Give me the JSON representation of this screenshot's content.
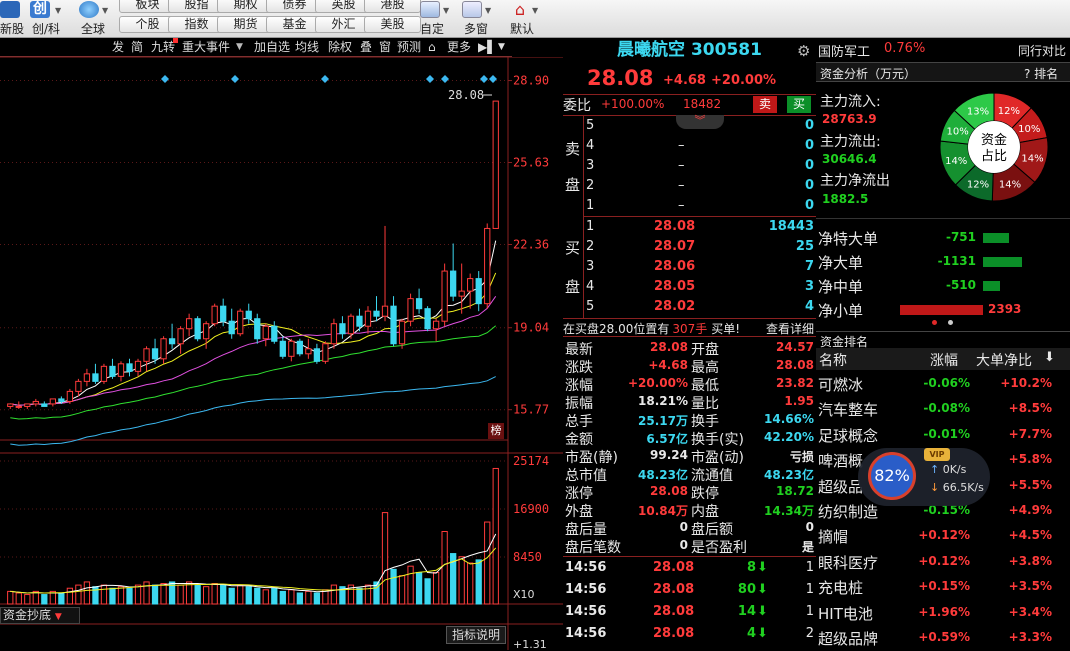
{
  "toolbar": {
    "left_labels": [
      "新股",
      "创/科",
      "全球"
    ],
    "buttons_row1": [
      "板块",
      "股指",
      "期权",
      "债券",
      "英股",
      "港股"
    ],
    "buttons_row2": [
      "个股",
      "指数",
      "期货",
      "基金",
      "外汇",
      "美股"
    ],
    "right_labels": [
      "自定",
      "多窗",
      "默认"
    ]
  },
  "chart_toolbar": {
    "items": [
      "发",
      "简",
      "九转",
      "重大事件",
      "加自选",
      "均线",
      "除权",
      "叠",
      "窗",
      "预测",
      "更多"
    ]
  },
  "kline": {
    "last_price_label": "28.08",
    "price_ticks": [
      "28.90",
      "25.63",
      "22.36",
      "19.04",
      "15.77"
    ],
    "volume_ticks": [
      "25174",
      "16900",
      "8450"
    ],
    "volume_unit": "X10",
    "rank_tag": "榜",
    "bottom_indicator": "资金抄底",
    "indicator_help": "指标说明",
    "bottom_tick": "+1.31",
    "candles": [
      [
        15.9,
        16.0,
        15.8,
        16.0
      ],
      [
        15.9,
        16.1,
        15.8,
        15.9
      ],
      [
        15.9,
        16.0,
        15.8,
        16.0
      ],
      [
        16.0,
        16.2,
        15.9,
        16.1
      ],
      [
        16.0,
        16.1,
        15.9,
        15.9
      ],
      [
        16.0,
        16.2,
        15.9,
        16.2
      ],
      [
        16.2,
        16.3,
        16.0,
        16.1
      ],
      [
        16.1,
        16.6,
        16.0,
        16.5
      ],
      [
        16.5,
        17.0,
        16.3,
        16.9
      ],
      [
        16.9,
        17.4,
        16.7,
        17.2
      ],
      [
        17.2,
        17.6,
        16.8,
        16.9
      ],
      [
        16.9,
        17.6,
        16.8,
        17.5
      ],
      [
        17.5,
        17.8,
        17.0,
        17.1
      ],
      [
        17.1,
        17.7,
        16.9,
        17.6
      ],
      [
        17.6,
        17.8,
        17.1,
        17.3
      ],
      [
        17.3,
        17.8,
        17.1,
        17.7
      ],
      [
        17.7,
        18.3,
        17.3,
        18.2
      ],
      [
        18.2,
        18.6,
        17.6,
        17.8
      ],
      [
        17.8,
        18.7,
        17.6,
        18.6
      ],
      [
        18.6,
        19.2,
        18.2,
        18.4
      ],
      [
        18.4,
        19.1,
        18.0,
        19.0
      ],
      [
        19.0,
        19.6,
        18.7,
        19.4
      ],
      [
        19.4,
        19.5,
        18.5,
        18.6
      ],
      [
        18.6,
        19.3,
        18.2,
        19.2
      ],
      [
        19.2,
        20.0,
        19.1,
        19.9
      ],
      [
        19.9,
        20.2,
        19.1,
        19.3
      ],
      [
        19.3,
        19.8,
        18.6,
        18.8
      ],
      [
        18.8,
        19.8,
        18.7,
        19.7
      ],
      [
        19.7,
        20.0,
        19.2,
        19.4
      ],
      [
        19.4,
        19.6,
        18.4,
        18.6
      ],
      [
        18.6,
        19.2,
        18.3,
        19.1
      ],
      [
        19.1,
        19.3,
        18.4,
        18.5
      ],
      [
        18.5,
        18.7,
        17.8,
        17.9
      ],
      [
        17.9,
        18.6,
        17.7,
        18.5
      ],
      [
        18.5,
        18.6,
        17.9,
        18.0
      ],
      [
        18.0,
        18.6,
        17.8,
        18.2
      ],
      [
        18.2,
        18.4,
        17.6,
        17.7
      ],
      [
        17.7,
        18.5,
        17.6,
        18.4
      ],
      [
        18.4,
        19.4,
        18.2,
        19.2
      ],
      [
        19.2,
        19.5,
        18.6,
        18.8
      ],
      [
        18.8,
        19.6,
        18.6,
        19.5
      ],
      [
        19.5,
        19.8,
        18.9,
        19.1
      ],
      [
        19.1,
        19.9,
        18.8,
        19.7
      ],
      [
        19.7,
        20.3,
        19.3,
        19.5
      ],
      [
        19.5,
        23.1,
        19.3,
        19.9
      ],
      [
        19.9,
        20.3,
        18.3,
        18.4
      ],
      [
        18.4,
        19.4,
        18.2,
        19.3
      ],
      [
        19.3,
        20.4,
        19.1,
        20.2
      ],
      [
        20.2,
        20.6,
        19.6,
        19.8
      ],
      [
        19.8,
        19.9,
        18.9,
        19.0
      ],
      [
        19.0,
        19.4,
        18.5,
        19.3
      ],
      [
        19.3,
        21.6,
        19.1,
        21.3
      ],
      [
        21.3,
        22.4,
        20.1,
        20.3
      ],
      [
        20.3,
        21.6,
        19.6,
        20.5
      ],
      [
        20.5,
        21.2,
        19.8,
        21.0
      ],
      [
        21.0,
        21.3,
        19.7,
        20.0
      ],
      [
        20.0,
        23.2,
        19.8,
        23.0
      ],
      [
        23.0,
        28.08,
        23.0,
        28.08
      ]
    ],
    "volumes": [
      0.4,
      0.35,
      0.3,
      0.4,
      0.3,
      0.4,
      0.35,
      0.5,
      0.6,
      0.7,
      0.55,
      0.6,
      0.5,
      0.55,
      0.5,
      0.6,
      0.7,
      0.6,
      0.65,
      0.7,
      0.6,
      0.7,
      0.6,
      0.55,
      0.65,
      0.6,
      0.5,
      0.6,
      0.55,
      0.5,
      0.45,
      0.5,
      0.4,
      0.45,
      0.35,
      0.4,
      0.35,
      0.45,
      0.6,
      0.55,
      0.6,
      0.5,
      0.6,
      0.7,
      2.9,
      1.1,
      0.9,
      1.2,
      1.0,
      0.8,
      1.0,
      2.3,
      1.6,
      1.5,
      1.3,
      1.4,
      2.6,
      4.3
    ]
  },
  "stock": {
    "name": "晨曦航空",
    "code": "300581",
    "price": "28.08",
    "change": "+4.68",
    "change_pct": "+20.00%",
    "weibi_label": "委比",
    "weibi_pct": "+100.00%",
    "weibi_num": "18482",
    "sell_btn": "卖",
    "buy_btn": "买",
    "sell_label": [
      "卖",
      "盘"
    ],
    "buy_label": [
      "买",
      "盘"
    ],
    "asks": [
      {
        "lvl": "5",
        "price": "",
        "vol": "0"
      },
      {
        "lvl": "4",
        "price": "–",
        "vol": "0"
      },
      {
        "lvl": "3",
        "price": "–",
        "vol": "0"
      },
      {
        "lvl": "2",
        "price": "–",
        "vol": "0"
      },
      {
        "lvl": "1",
        "price": "–",
        "vol": "0"
      }
    ],
    "bids": [
      {
        "lvl": "1",
        "price": "28.08",
        "vol": "18443"
      },
      {
        "lvl": "2",
        "price": "28.07",
        "vol": "25"
      },
      {
        "lvl": "3",
        "price": "28.06",
        "vol": "7"
      },
      {
        "lvl": "4",
        "price": "28.05",
        "vol": "3"
      },
      {
        "lvl": "5",
        "price": "28.02",
        "vol": "4"
      }
    ],
    "position_note_a": "在买盘28.00位置有",
    "position_note_b": "307手",
    "position_note_c": "买单!",
    "position_detail": "查看详细",
    "quotes": [
      [
        "最新",
        "28.08",
        "red",
        "开盘",
        "24.57",
        "red"
      ],
      [
        "涨跌",
        "+4.68",
        "red",
        "最高",
        "28.08",
        "red"
      ],
      [
        "涨幅",
        "+20.00%",
        "red",
        "最低",
        "23.82",
        "red"
      ],
      [
        "振幅",
        "18.21%",
        "white",
        "量比",
        "1.95",
        "red"
      ],
      [
        "总手",
        "25.17万",
        "cyan",
        "换手",
        "14.66%",
        "cyan"
      ],
      [
        "金额",
        "6.57亿",
        "cyan",
        "换手(实)",
        "42.20%",
        "cyan"
      ],
      [
        "市盈(静)",
        "99.24",
        "white",
        "市盈(动)",
        "亏损",
        "white"
      ],
      [
        "总市值",
        "48.23亿",
        "cyan",
        "流通值",
        "48.23亿",
        "cyan"
      ],
      [
        "涨停",
        "28.08",
        "red",
        "跌停",
        "18.72",
        "green"
      ],
      [
        "外盘",
        "10.84万",
        "red",
        "内盘",
        "14.34万",
        "green"
      ],
      [
        "盘后量",
        "0",
        "white",
        "盘后额",
        "0",
        "white"
      ],
      [
        "盘后笔数",
        "0",
        "white",
        "是否盈利",
        "是",
        "white"
      ]
    ],
    "ticks": [
      {
        "time": "14:56",
        "price": "28.08",
        "vol": "8",
        "tail": "1"
      },
      {
        "time": "14:56",
        "price": "28.08",
        "vol": "80",
        "tail": "1"
      },
      {
        "time": "14:56",
        "price": "28.08",
        "vol": "14",
        "tail": "1"
      },
      {
        "time": "14:56",
        "price": "28.08",
        "vol": "4",
        "tail": "2"
      }
    ]
  },
  "fund": {
    "sector": "国防军工",
    "sector_pct": "0.76%",
    "compare": "同行对比",
    "analysis_title": "资金分析（万元）",
    "rank_label": "? 排名",
    "inflow_label": "主力流入:",
    "inflow": "28763.9",
    "outflow_label": "主力流出:",
    "outflow": "30646.4",
    "net_label": "主力净流出",
    "net": "1882.5",
    "donut_center": [
      "资金",
      "占比"
    ],
    "donut_segments": [
      {
        "pct": 12,
        "label": "12%",
        "color": "#e02828"
      },
      {
        "pct": 10,
        "label": "10%",
        "color": "#c41c1c"
      },
      {
        "pct": 14,
        "label": "14%",
        "color": "#a01818"
      },
      {
        "pct": 14,
        "label": "14%",
        "color": "#7a1010"
      },
      {
        "pct": 12,
        "label": "12%",
        "color": "#0c6a2a"
      },
      {
        "pct": 14,
        "label": "14%",
        "color": "#15902f"
      },
      {
        "pct": 10,
        "label": "10%",
        "color": "#1eae3a"
      },
      {
        "pct": 13,
        "label": "13%",
        "color": "#2dc948"
      }
    ],
    "net_rows": [
      {
        "label": "净特大单",
        "value": "-751",
        "color": "green",
        "ratio": 0.31
      },
      {
        "label": "净大单",
        "value": "-1131",
        "color": "green",
        "ratio": 0.47
      },
      {
        "label": "净中单",
        "value": "-510",
        "color": "green",
        "ratio": 0.21
      },
      {
        "label": "净小单",
        "value": "2393",
        "color": "red",
        "ratio": 1.0
      }
    ],
    "rank_title": "资金排名",
    "rank_headers": [
      "名称",
      "涨幅",
      "大单净比"
    ],
    "rank_rows": [
      [
        "可燃冰",
        "-0.06%",
        "+10.2%"
      ],
      [
        "汽车整车",
        "-0.08%",
        "+8.5%"
      ],
      [
        "足球概念",
        "-0.01%",
        "+7.7%"
      ],
      [
        "啤酒概",
        "",
        "+5.8%"
      ],
      [
        "超级品",
        "",
        "+5.5%"
      ],
      [
        "纺织制造",
        "-0.15%",
        "+4.9%"
      ],
      [
        "摘帽",
        "+0.12%",
        "+4.5%"
      ],
      [
        "眼科医疗",
        "+0.12%",
        "+3.8%"
      ],
      [
        "充电桩",
        "+0.15%",
        "+3.5%"
      ],
      [
        "HIT电池",
        "+1.96%",
        "+3.4%"
      ],
      [
        "超级品牌",
        "+0.59%",
        "+3.3%"
      ]
    ]
  },
  "speed_widget": {
    "percent": "82%",
    "up": "0K/s",
    "down": "66.5K/s",
    "vip": "VIP"
  },
  "colors": {
    "up": "#ff3b3b",
    "down": "#20d020",
    "cyan": "#3cd8f0",
    "frame": "#8a2020"
  }
}
